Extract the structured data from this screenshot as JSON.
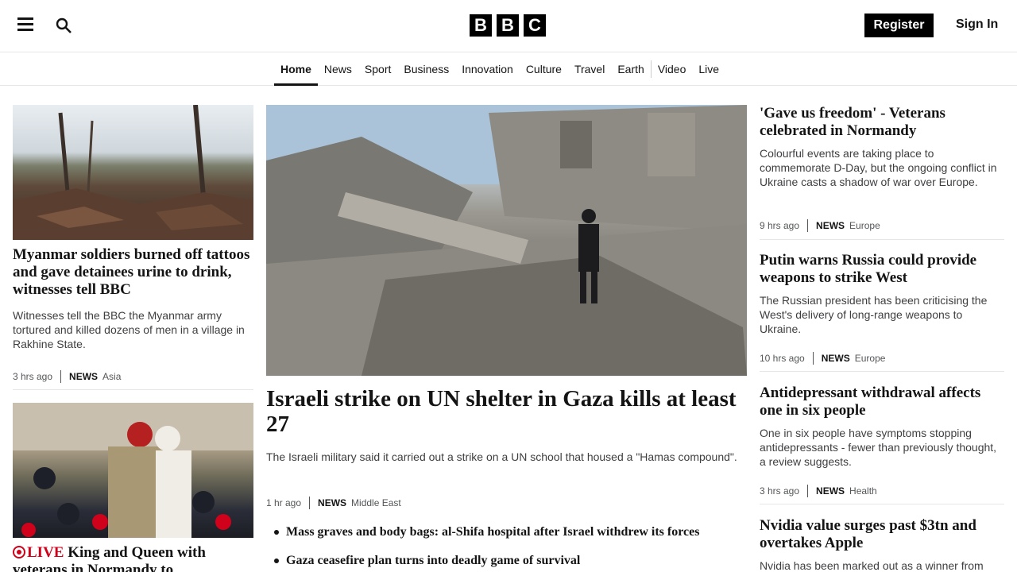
{
  "header": {
    "logo_letters": [
      "B",
      "B",
      "C"
    ],
    "register_label": "Register",
    "signin_label": "Sign In"
  },
  "nav": {
    "items": [
      {
        "label": "Home",
        "active": true
      },
      {
        "label": "News"
      },
      {
        "label": "Sport"
      },
      {
        "label": "Business"
      },
      {
        "label": "Innovation"
      },
      {
        "label": "Culture"
      },
      {
        "label": "Travel"
      },
      {
        "label": "Earth"
      },
      {
        "label": "Video"
      },
      {
        "label": "Live"
      }
    ]
  },
  "left": {
    "story1": {
      "headline": "Myanmar soldiers burned off tattoos and gave detainees urine to drink, witnesses tell BBC",
      "summary": "Witnesses tell the BBC the Myanmar army tortured and killed dozens of men in a village in Rakhine State.",
      "time": "3 hrs ago",
      "section": "NEWS",
      "topic": "Asia"
    },
    "story2": {
      "live_label": "LIVE",
      "headline": "King and Queen with veterans in Normandy to"
    }
  },
  "main": {
    "headline": "Israeli strike on UN shelter in Gaza kills at least 27",
    "summary": "The Israeli military said it carried out a strike on a UN school that housed a \"Hamas compound\".",
    "time": "1 hr ago",
    "section": "NEWS",
    "topic": "Middle East",
    "related": [
      "Mass graves and body bags: al-Shifa hospital after Israel withdrew its forces",
      "Gaza ceasefire plan turns into deadly game of survival"
    ]
  },
  "right": {
    "stories": [
      {
        "headline": "'Gave us freedom' - Veterans celebrated in Normandy",
        "summary": "Colourful events are taking place to commemorate D-Day, but the ongoing conflict in Ukraine casts a shadow of war over Europe.",
        "time": "9 hrs ago",
        "section": "NEWS",
        "topic": "Europe"
      },
      {
        "headline": "Putin warns Russia could provide weapons to strike West",
        "summary": "The Russian president has been criticising the West's delivery of long-range weapons to Ukraine.",
        "time": "10 hrs ago",
        "section": "NEWS",
        "topic": "Europe"
      },
      {
        "headline": "Antidepressant withdrawal affects one in six people",
        "summary": "One in six people have symptoms stopping antidepressants - fewer than previously thought, a review suggests.",
        "time": "3 hrs ago",
        "section": "NEWS",
        "topic": "Health"
      },
      {
        "headline": "Nvidia value surges past $3tn and overtakes Apple",
        "summary": "Nvidia has been marked out as a winner from"
      }
    ]
  }
}
